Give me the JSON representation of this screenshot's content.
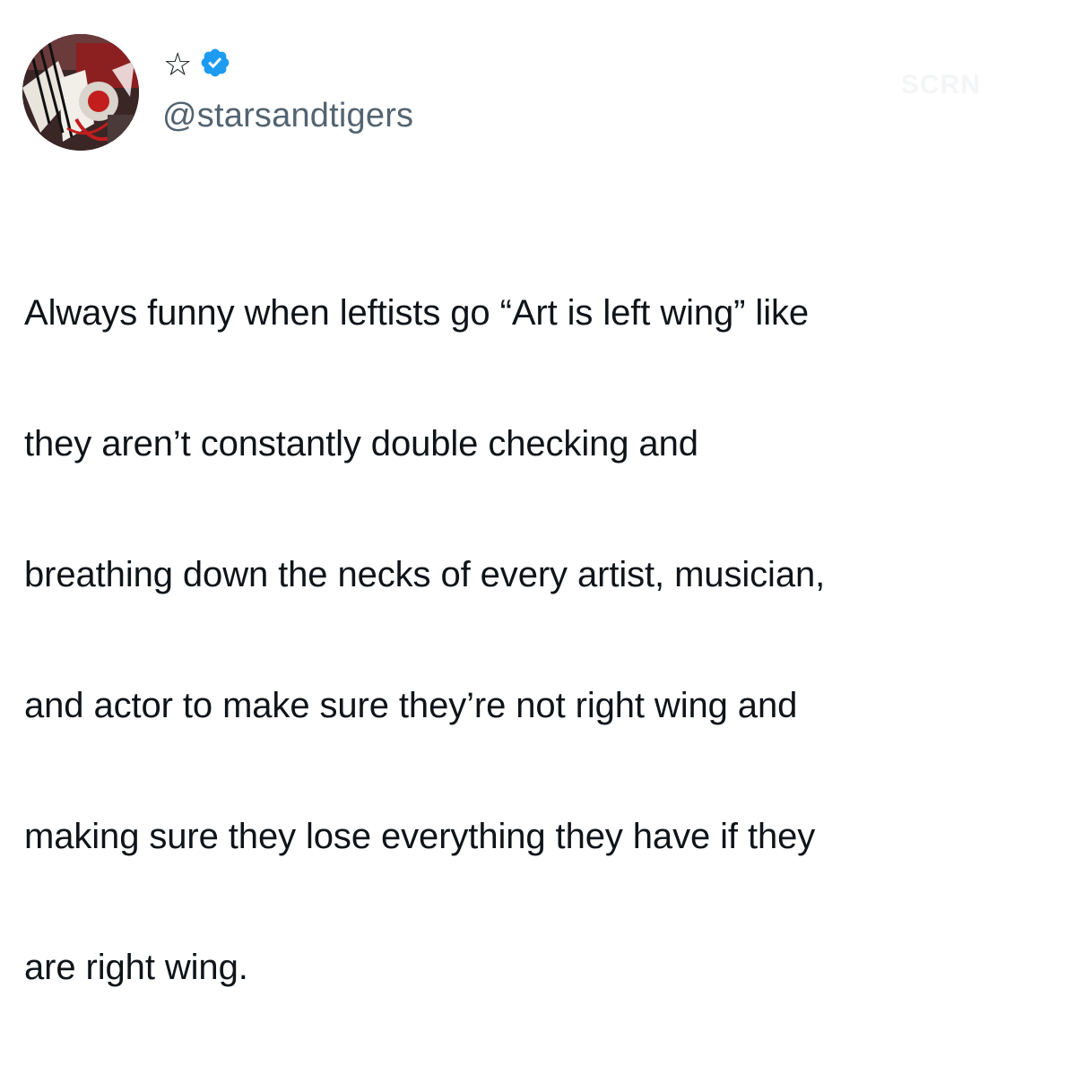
{
  "tweet": {
    "display_name_glyph": "☆",
    "verified": true,
    "handle": "@starsandtigers",
    "watermark": "SCRN",
    "text_lines": [
      "Always funny when leftists go “Art is left wing” like",
      "they aren’t constantly double checking and",
      "breathing down the necks of every artist, musician,",
      "and actor to make sure they’re not right wing and",
      "making sure they lose everything they have if they",
      "are right wing."
    ]
  },
  "icons": {
    "avatar": "profile-avatar",
    "verified": "verified-badge-icon",
    "name": "star-icon"
  },
  "colors": {
    "verified_blue": "#1d9bf0",
    "text": "#0f1419",
    "handle": "#536471"
  }
}
